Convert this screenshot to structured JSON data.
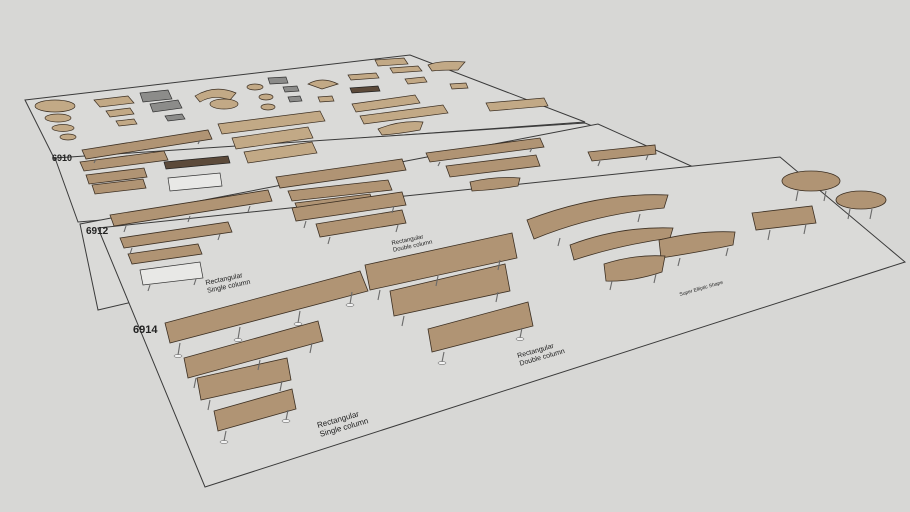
{
  "scene": {
    "background": "#d7d7d5",
    "colors": {
      "wood": "#b09474",
      "frame": "#3a3a3a",
      "grey_top": "#8c8c8a"
    }
  },
  "panels": {
    "series_6910": {
      "code": "6910"
    },
    "series_6912": {
      "code": "6912",
      "label_single": "Rectangular\nSingle column",
      "label_double": "Rectangular\nDouble column"
    },
    "series_6914": {
      "code": "6914",
      "label_single": "Rectangular\nSingle column",
      "label_double": "Rectangular\nDouble column",
      "label_boat": "Super Elliptic Shape"
    }
  }
}
